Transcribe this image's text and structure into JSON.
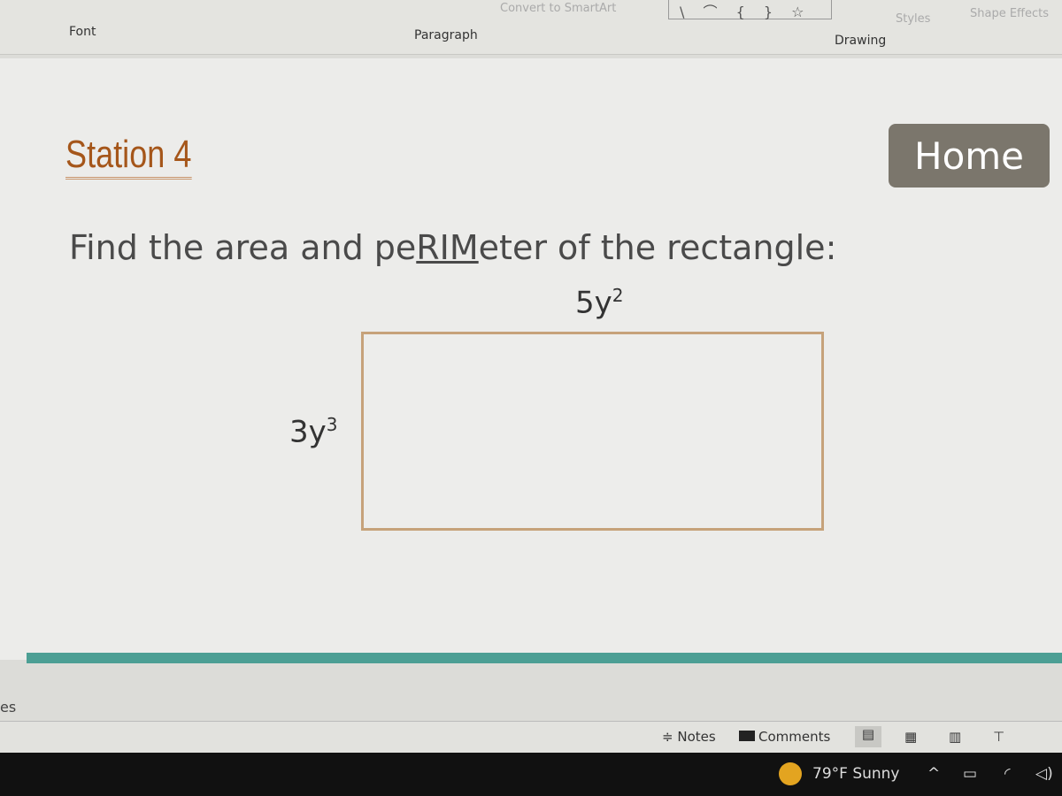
{
  "ribbon": {
    "convert_smartart": "Convert to SmartArt",
    "shapes_glyphs": "\\ ⌒ { } ☆",
    "styles": "Styles",
    "shape_effects": "Shape Effects",
    "groups": [
      "Font",
      "Paragraph",
      "Drawing"
    ]
  },
  "slide": {
    "title": "Station 4",
    "home_button": "Home",
    "question_pre": "Find the area and pe",
    "question_u": "RIM",
    "question_post": "eter of the rectangle:",
    "width_base": "5y",
    "width_exp": "2",
    "height_base": "3y",
    "height_exp": "3",
    "accent": "#4c9f94",
    "title_color": "#a5561a"
  },
  "side_fragment": "es",
  "status": {
    "notes": "Notes",
    "comments": "Comments"
  },
  "taskbar": {
    "weather": "79°F  Sunny",
    "weather_icon": "sun-icon"
  }
}
